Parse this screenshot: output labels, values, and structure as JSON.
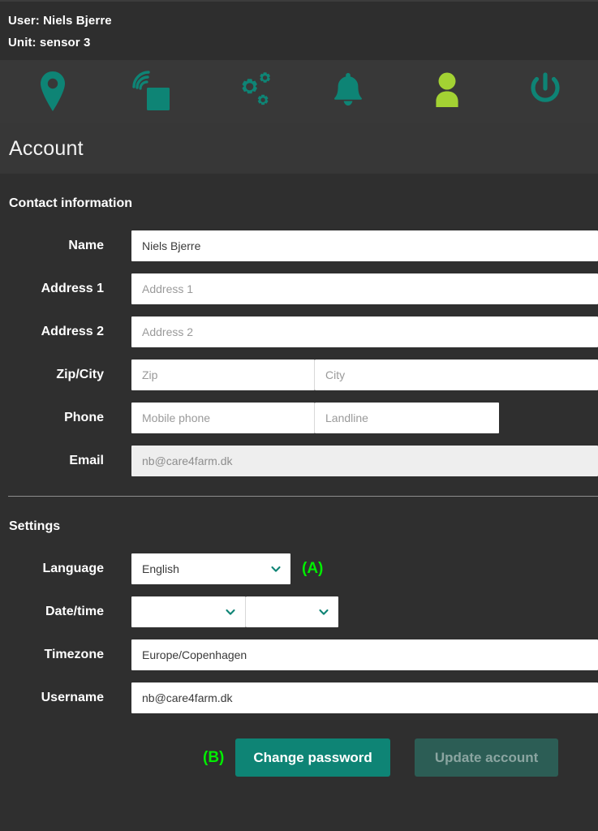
{
  "header": {
    "user_line": "User: Niels Bjerre",
    "unit_line": "Unit: sensor 3",
    "nav": [
      {
        "name": "location-pin-icon",
        "label": "Location"
      },
      {
        "name": "sensor-signal-icon",
        "label": "Unit"
      },
      {
        "name": "gears-icon",
        "label": "Settings"
      },
      {
        "name": "bell-icon",
        "label": "Alarms"
      },
      {
        "name": "person-icon",
        "label": "Account"
      },
      {
        "name": "power-icon",
        "label": "Log out"
      }
    ],
    "active_nav_index": 4
  },
  "page": {
    "title": "Account"
  },
  "contact": {
    "heading": "Contact information",
    "name_label": "Name",
    "name_value": "Niels Bjerre",
    "address1_label": "Address 1",
    "address1_placeholder": "Address 1",
    "address2_label": "Address 2",
    "address2_placeholder": "Address 2",
    "zipcity_label": "Zip/City",
    "zip_placeholder": "Zip",
    "city_placeholder": "City",
    "phone_label": "Phone",
    "mobile_placeholder": "Mobile phone",
    "landline_placeholder": "Landline",
    "email_label": "Email",
    "email_value": "nb@care4farm.dk"
  },
  "settings": {
    "heading": "Settings",
    "language_label": "Language",
    "language_value": "English",
    "language_annotation": "(A)",
    "datetime_label": "Date/time",
    "date_value": "",
    "time_value": "",
    "timezone_label": "Timezone",
    "timezone_value": "Europe/Copenhagen",
    "username_label": "Username",
    "username_value": "nb@care4farm.dk"
  },
  "actions": {
    "change_password_annotation": "(B)",
    "change_password_label": "Change password",
    "update_account_label": "Update account"
  },
  "colors": {
    "teal": "#0e8475",
    "teal_disabled": "#2c5d55",
    "lime_active": "#a3d233",
    "annotation_green": "#00ee00",
    "background": "#2f2f2f",
    "iconbar": "#383838"
  }
}
